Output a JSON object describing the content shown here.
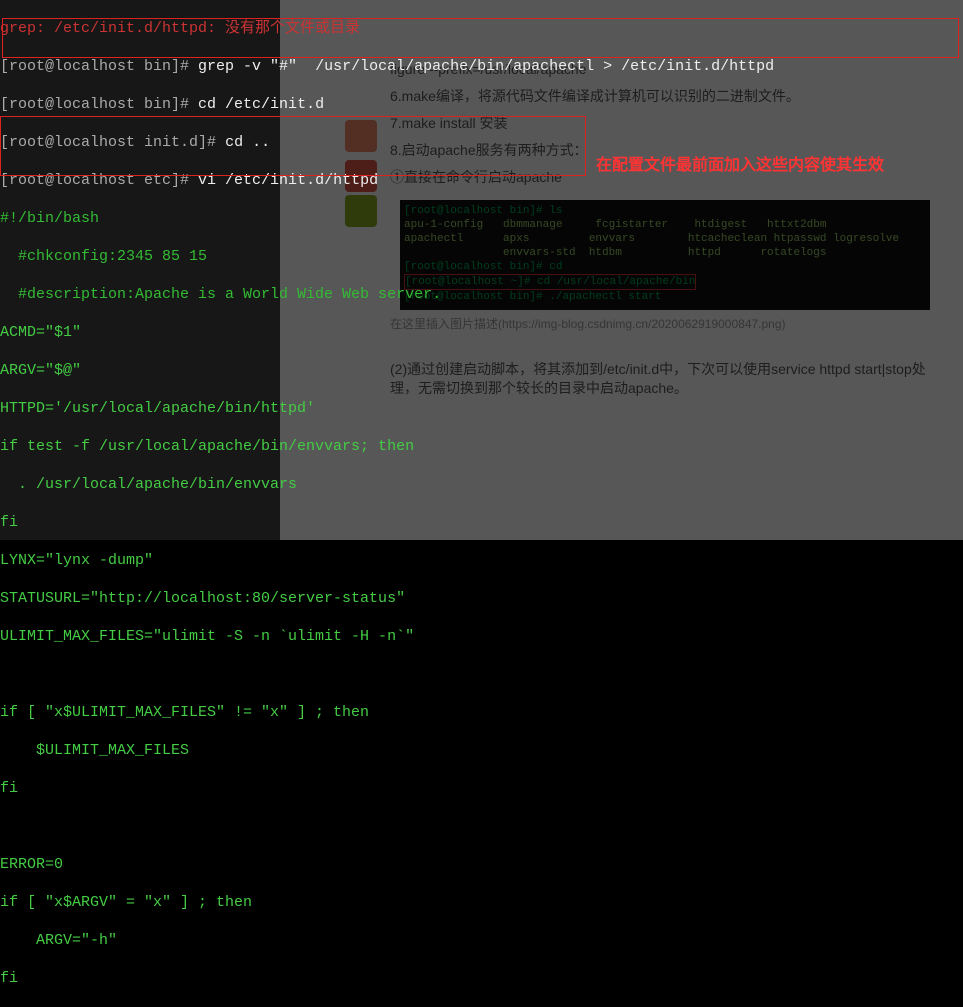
{
  "grep_err": "grep: /etc/init.d/httpd: 没有那个文件或目录",
  "p1_user": "[root@localhost bin]#",
  "p1_cmd": "grep -v \"#\"  /usr/local/apache/bin/apachectl > /etc/init.d/httpd",
  "p2_user": "[root@localhost bin]#",
  "p2_cmd": "cd /etc/init.d",
  "p3_user": "[root@localhost init.d]#",
  "p3_cmd": "cd ..",
  "p4_user": "[root@localhost etc]#",
  "p4_cmd": "vi /etc/init.d/httpd",
  "shebang": "#!/bin/bash",
  "cfg1": "  #chkconfig:2345 85 15",
  "cfg2": "  #description:Apache is a World Wide Web server.",
  "l1": "ACMD=\"$1\"",
  "l2": "ARGV=\"$@\"",
  "l3": "HTTPD='/usr/local/apache/bin/httpd'",
  "l4": "if test -f /usr/local/apache/bin/envvars; then",
  "l5": "  . /usr/local/apache/bin/envvars",
  "l6": "fi",
  "l7": "LYNX=\"lynx -dump\"",
  "l8": "STATUSURL=\"http://localhost:80/server-status\"",
  "l9": "ULIMIT_MAX_FILES=\"ulimit -S -n `ulimit -H -n`\"",
  "l10": "",
  "l11": "if [ \"x$ULIMIT_MAX_FILES\" != \"x\" ] ; then",
  "l12": "    $ULIMIT_MAX_FILES",
  "l13": "fi",
  "l14": "",
  "l15": "ERROR=0",
  "l16": "if [ \"x$ARGV\" = \"x\" ] ; then",
  "l17": "    ARGV=\"-h\"",
  "l18": "fi",
  "annotation": "在配置文件最前面加入这些内容使其生效",
  "bg": {
    "r0": "figure --prefix=/usr/local/apache",
    "r1": "6.make编译，将源代码文件编译成计算机可以识别的二进制文件。",
    "r2": "7.make install 安装",
    "r3": "8.启动apache服务有两种方式：",
    "r4": "①直接在命令行启动apache",
    "link": "在这里插入图片描述(https://img-blog.csdnimg.cn/2020062919000847.png)",
    "r5": "(2)通过创建启动脚本，将其添加到/etc/init.d中，下次可以使用service httpd start|stop处理，无需切换到那个较长的目录中启动apache。",
    "t2_p1": "[root@localhost bin]# ls",
    "t2_col": "apu-1-config   dbmmanage     fcgistarter    htdigest   httxt2dbm\napachectl      apxs         envvars        htcacheclean htpasswd logresolve\n               envvars-std  htdbm          httpd      rotatelogs",
    "t2_p2": "[root@localhost bin]# cd",
    "t2_p3": "[root@localhost ~]# cd /usr/local/apache/bin",
    "t2_p4": "[root@localhost bin]# ./apachectl start"
  }
}
